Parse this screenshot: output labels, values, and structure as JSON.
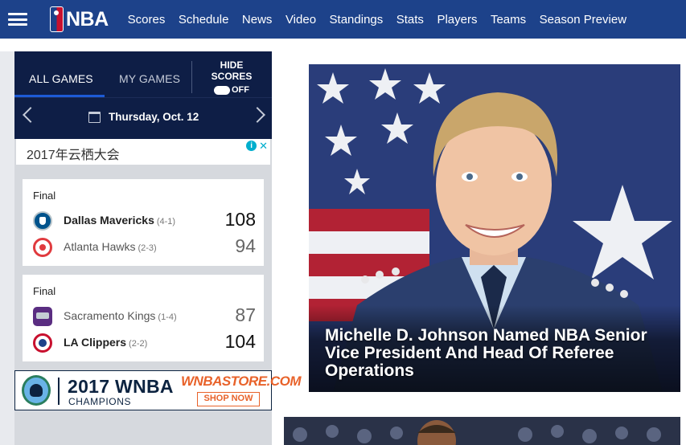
{
  "nav": {
    "brand": "NBA",
    "links": [
      "Scores",
      "Schedule",
      "News",
      "Video",
      "Standings",
      "Stats",
      "Players",
      "Teams",
      "Season Preview"
    ]
  },
  "scoreboard": {
    "tabs": {
      "all": "ALL GAMES",
      "my": "MY GAMES"
    },
    "hide_scores": {
      "label_line1": "HIDE",
      "label_line2": "SCORES",
      "state": "OFF"
    },
    "date": "Thursday, Oct. 12"
  },
  "ad_strip": {
    "text": "2017年云栖大会",
    "info": "i",
    "close": "✕"
  },
  "games": [
    {
      "status": "Final",
      "home": {
        "name": "Dallas Mavericks",
        "record": "(4-1)",
        "score": "108"
      },
      "away": {
        "name": "Atlanta Hawks",
        "record": "(2-3)",
        "score": "94"
      }
    },
    {
      "status": "Final",
      "home": {
        "name": "Sacramento Kings",
        "record": "(1-4)",
        "score": "87"
      },
      "away": {
        "name": "LA Clippers",
        "record": "(2-2)",
        "score": "104"
      }
    }
  ],
  "banner_ad": {
    "title": "2017 WNBA",
    "subtitle": "CHAMPIONS",
    "store": "WNBASTORE.COM",
    "cta": "SHOP NOW"
  },
  "hero": {
    "headline": "Michelle D. Johnson Named NBA Senior Vice President And Head Of Referee Operations"
  },
  "colors": {
    "nav_bg": "#1d428a",
    "scoreboard_bg": "#0e1e46",
    "accent_blue": "#1d5bd6",
    "store_orange": "#e8622a"
  }
}
